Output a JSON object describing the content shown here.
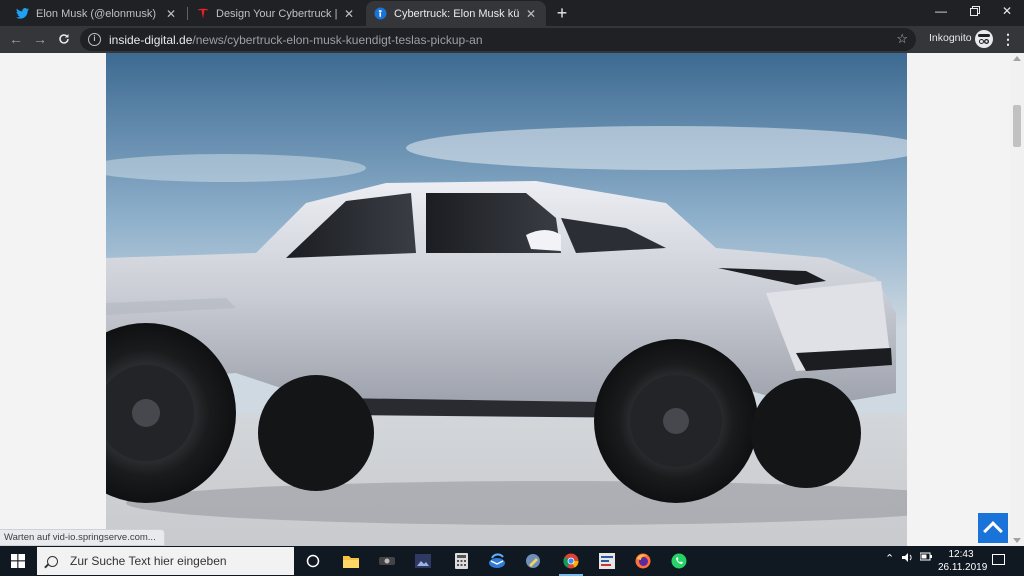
{
  "browser": {
    "tabs": [
      {
        "title": "Elon Musk (@elonmusk) | Twitter",
        "icon": "twitter-bird-icon"
      },
      {
        "title": "Design Your Cybertruck | Tesla",
        "icon": "tesla-logo-icon"
      },
      {
        "title": "Cybertruck: Elon Musk kündigt Tesla",
        "icon": "inside-digital-icon"
      }
    ],
    "new_tab": "+",
    "url_host": "inside-digital.de",
    "url_path": "/news/cybertruck-elon-musk-kuendigt-teslas-pickup-an",
    "incognito_label": "Inkognito"
  },
  "page": {
    "hero_image": "tesla-pickup-concept-render",
    "status_text": "Warten auf vid-io.springserve.com..."
  },
  "taskbar": {
    "search_placeholder": "Zur Suche Text hier eingeben",
    "apps": [
      "task-view-icon",
      "file-explorer-icon",
      "app-dark-icon",
      "image-viewer-icon",
      "calculator-icon",
      "thunderbird-icon",
      "app-pencil-icon",
      "chrome-icon",
      "app-settings-icon",
      "firefox-icon",
      "whatsapp-icon"
    ],
    "time": "12:43",
    "date": "26.11.2019"
  },
  "colors": {
    "accent": "#1a73d9",
    "taskbar": "#101822",
    "tabstrip": "#202124"
  }
}
